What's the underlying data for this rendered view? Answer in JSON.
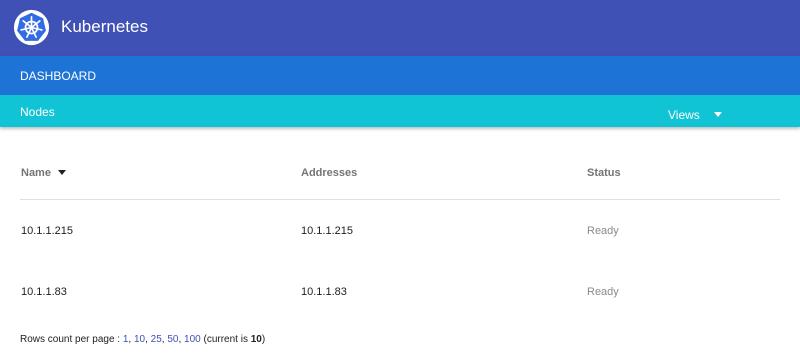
{
  "app": {
    "title": "Kubernetes"
  },
  "nav": {
    "dashboard_label": "DASHBOARD"
  },
  "section": {
    "title": "Nodes",
    "views_label": "Views"
  },
  "table": {
    "columns": [
      "Name",
      "Addresses",
      "Status"
    ],
    "rows": [
      {
        "name": "10.1.1.215",
        "address": "10.1.1.215",
        "status": "Ready"
      },
      {
        "name": "10.1.1.83",
        "address": "10.1.1.83",
        "status": "Ready"
      }
    ]
  },
  "pagination": {
    "label": "Rows count per page : ",
    "options": [
      "1",
      "10",
      "25",
      "50",
      "100"
    ],
    "current_prefix": "(current is ",
    "current": "10",
    "current_suffix": ")"
  },
  "icons": {
    "logo": "kubernetes-helm-icon",
    "views_caret": "caret-down-icon",
    "sort": "sort-desc-icon"
  },
  "colors": {
    "topbar": "#3f51b5",
    "dashbar": "#1e73d6",
    "nodesbar": "#10c4d6",
    "link": "#3f51b5"
  }
}
